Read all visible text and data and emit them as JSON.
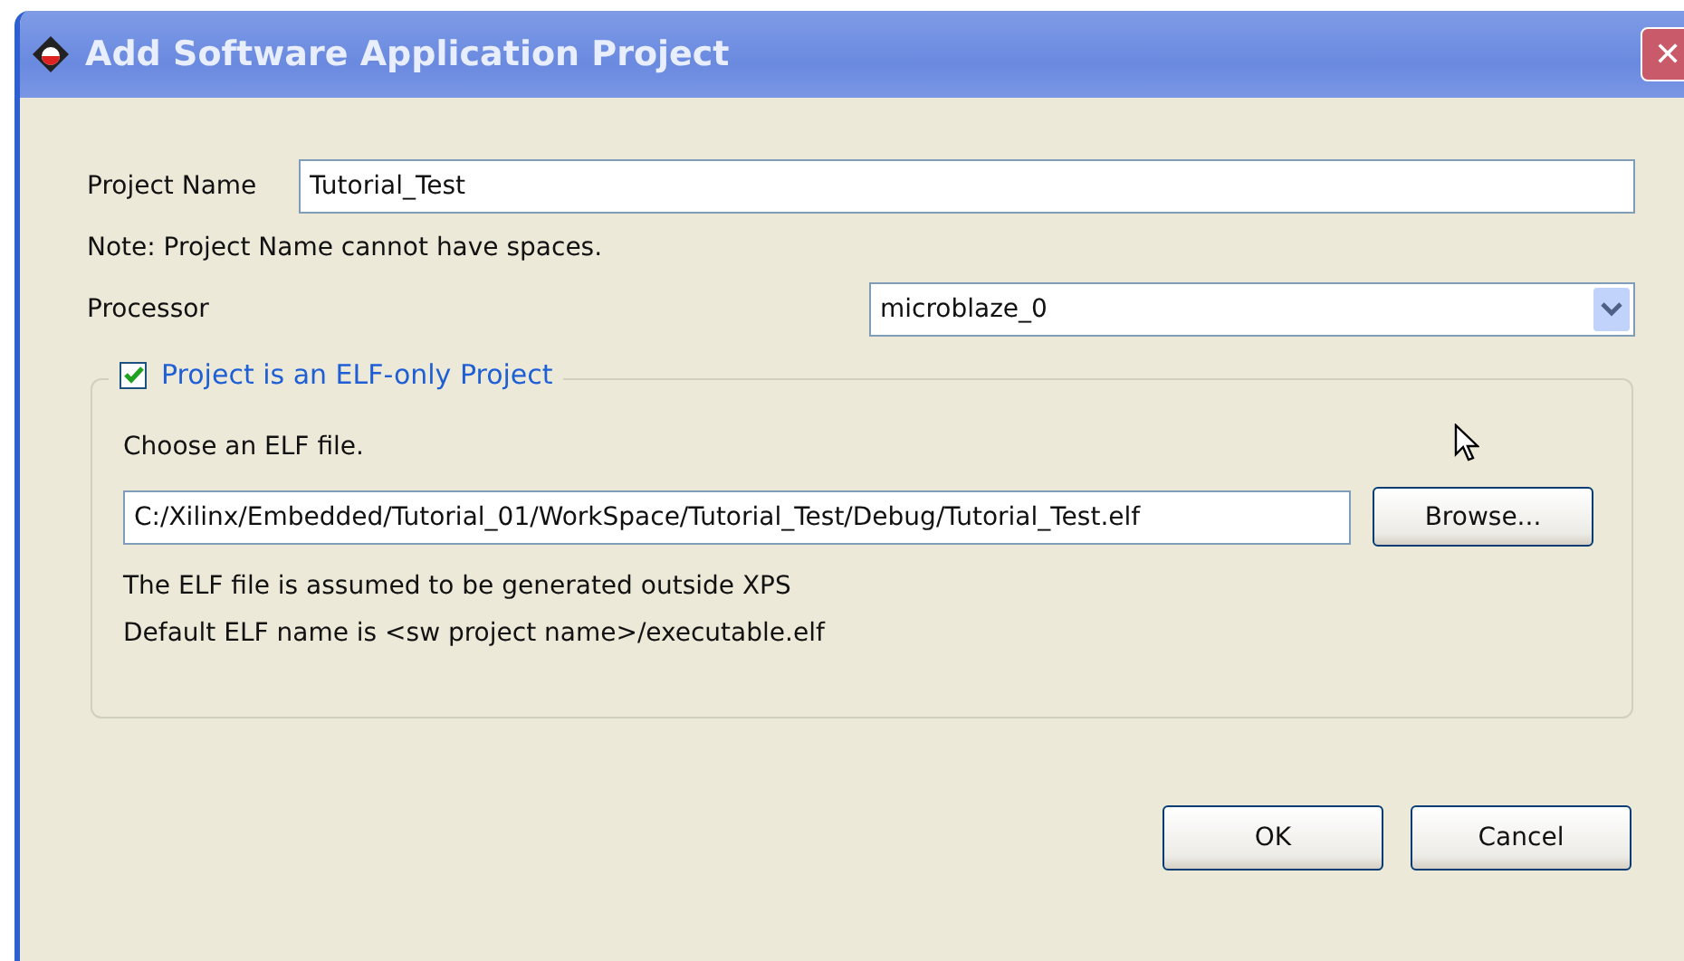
{
  "window": {
    "title": "Add Software Application Project",
    "close": "✕"
  },
  "project_name": {
    "label": "Project Name",
    "value": "Tutorial_Test"
  },
  "note": "Note: Project Name cannot have spaces.",
  "processor": {
    "label": "Processor",
    "value": "microblaze_0"
  },
  "elf_group": {
    "checkbox": {
      "label": "Project is an ELF-only Project",
      "checked": true
    },
    "choose_label": "Choose an ELF file.",
    "path": {
      "value": "C:/Xilinx/Embedded/Tutorial_01/WorkSpace/Tutorial_Test/Debug/Tutorial_Test.elf"
    },
    "browse": "Browse...",
    "info": [
      "The ELF file is assumed to be generated outside XPS",
      "Default ELF name is <sw project name>/executable.elf"
    ]
  },
  "buttons": [
    "OK",
    "Cancel"
  ]
}
